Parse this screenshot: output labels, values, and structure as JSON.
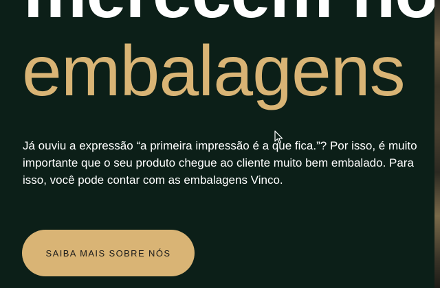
{
  "hero": {
    "headline_line1": "merecem nos",
    "headline_line2": "embalagens",
    "description": "Já ouviu a expressão “a primeira impressão é a que fica.”? Por isso, é muito importante que o seu produto chegue ao cliente muito bem embalado. Para isso, você pode contar com as embalagens Vinco.",
    "cta_label": "SAIBA MAIS SOBRE NÓS"
  },
  "colors": {
    "background": "#0c1f18",
    "accent": "#d9b475",
    "text": "#ffffff",
    "button_text": "#1a1a1a"
  },
  "icons": {
    "cursor": "mouse-pointer-icon"
  }
}
